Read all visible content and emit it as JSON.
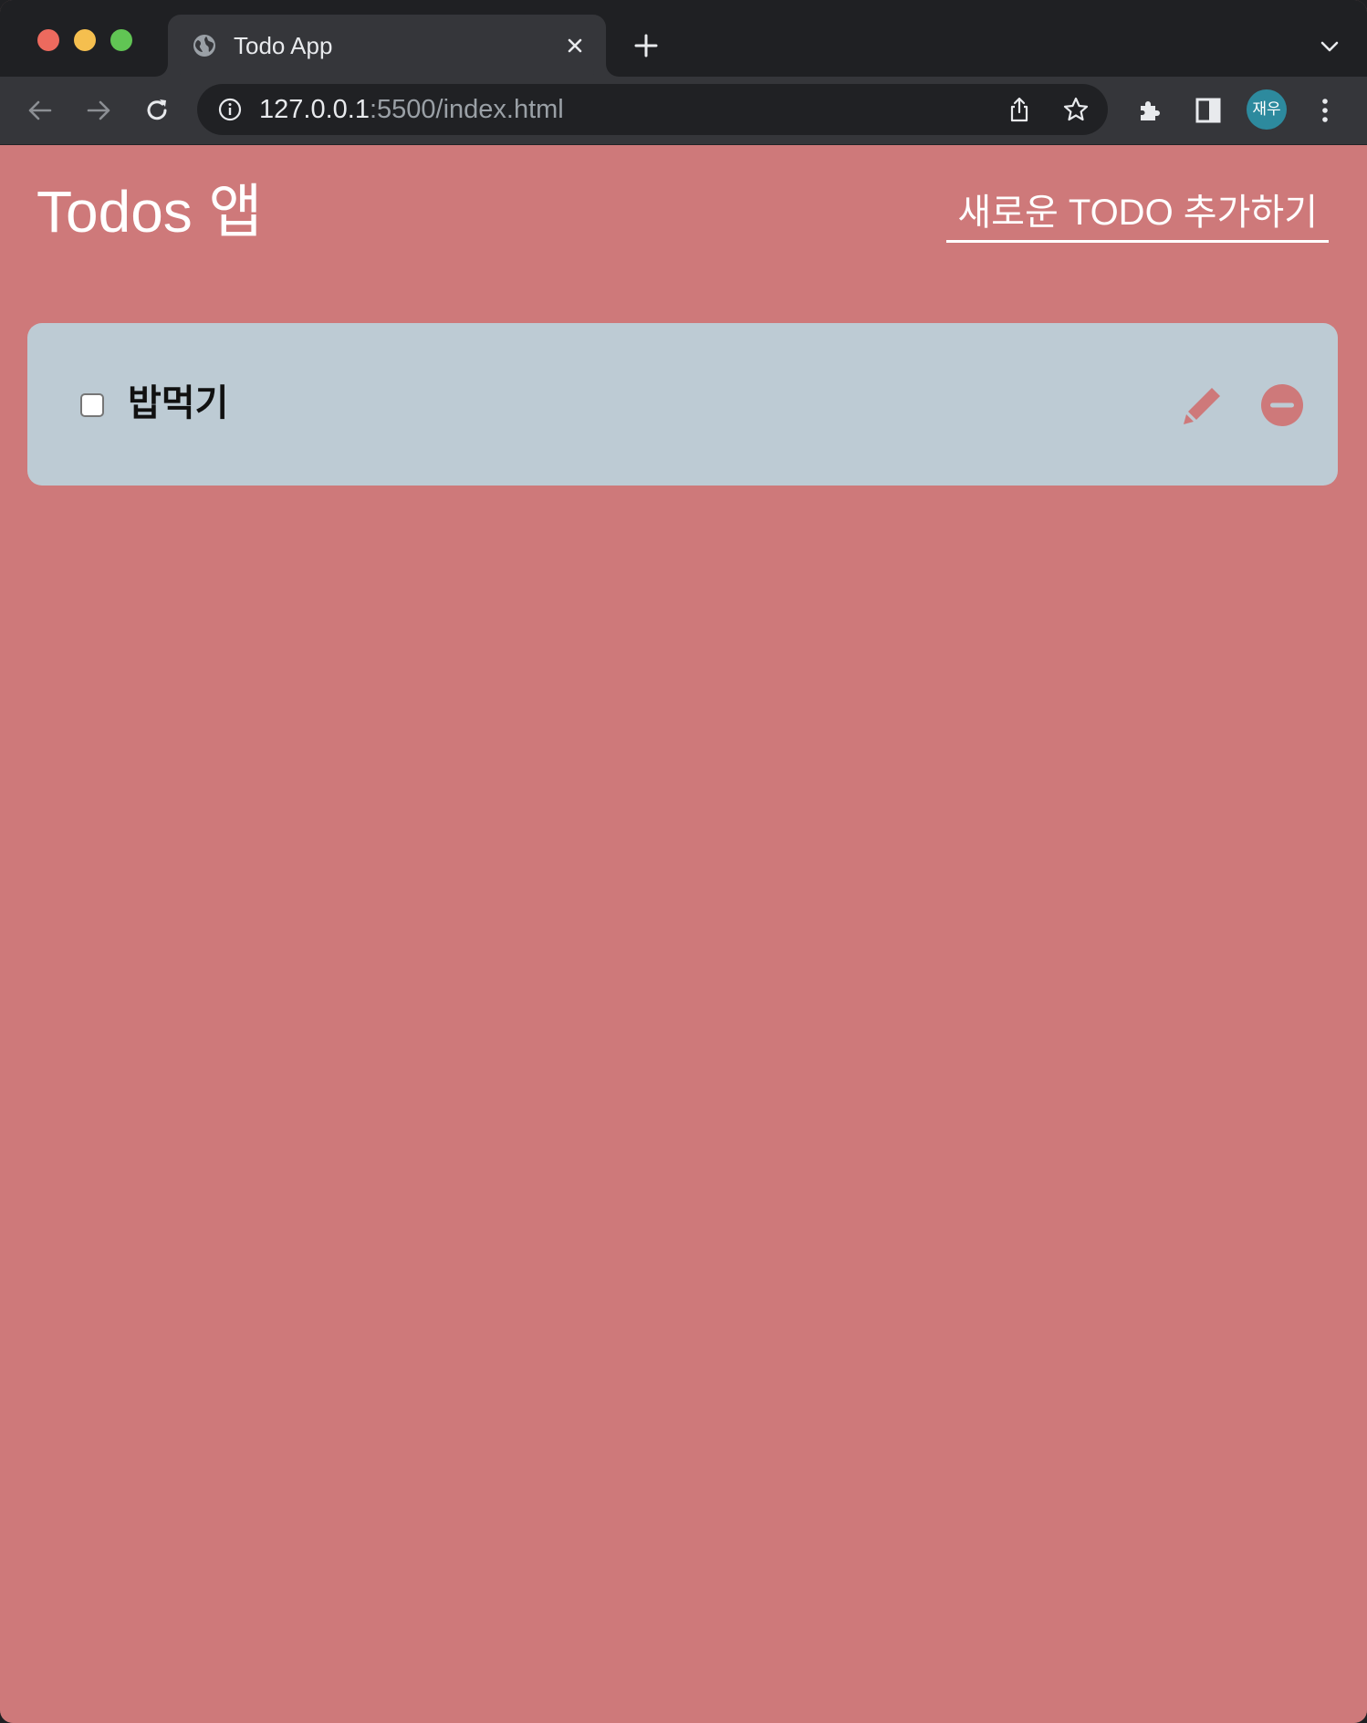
{
  "browser": {
    "tab": {
      "title": "Todo App",
      "favicon": "globe-icon"
    },
    "url": {
      "host": "127.0.0.1",
      "path": ":5500/index.html"
    },
    "profile": {
      "label": "재우",
      "color": "#2d8a9e"
    }
  },
  "page": {
    "background": "#ce797a",
    "title": "Todos 앱",
    "add_button_label": "새로운 TODO 추가하기",
    "todos": [
      {
        "text": "밥먹기",
        "checked": false,
        "card_color": "#bdcbd4",
        "edit_icon": "pencil-icon",
        "delete_icon": "minus-circle-icon"
      }
    ]
  },
  "colors": {
    "accent": "#ce797a",
    "tabstrip": "#1f2023",
    "toolbar": "#35363a",
    "omnibox": "#202124"
  }
}
